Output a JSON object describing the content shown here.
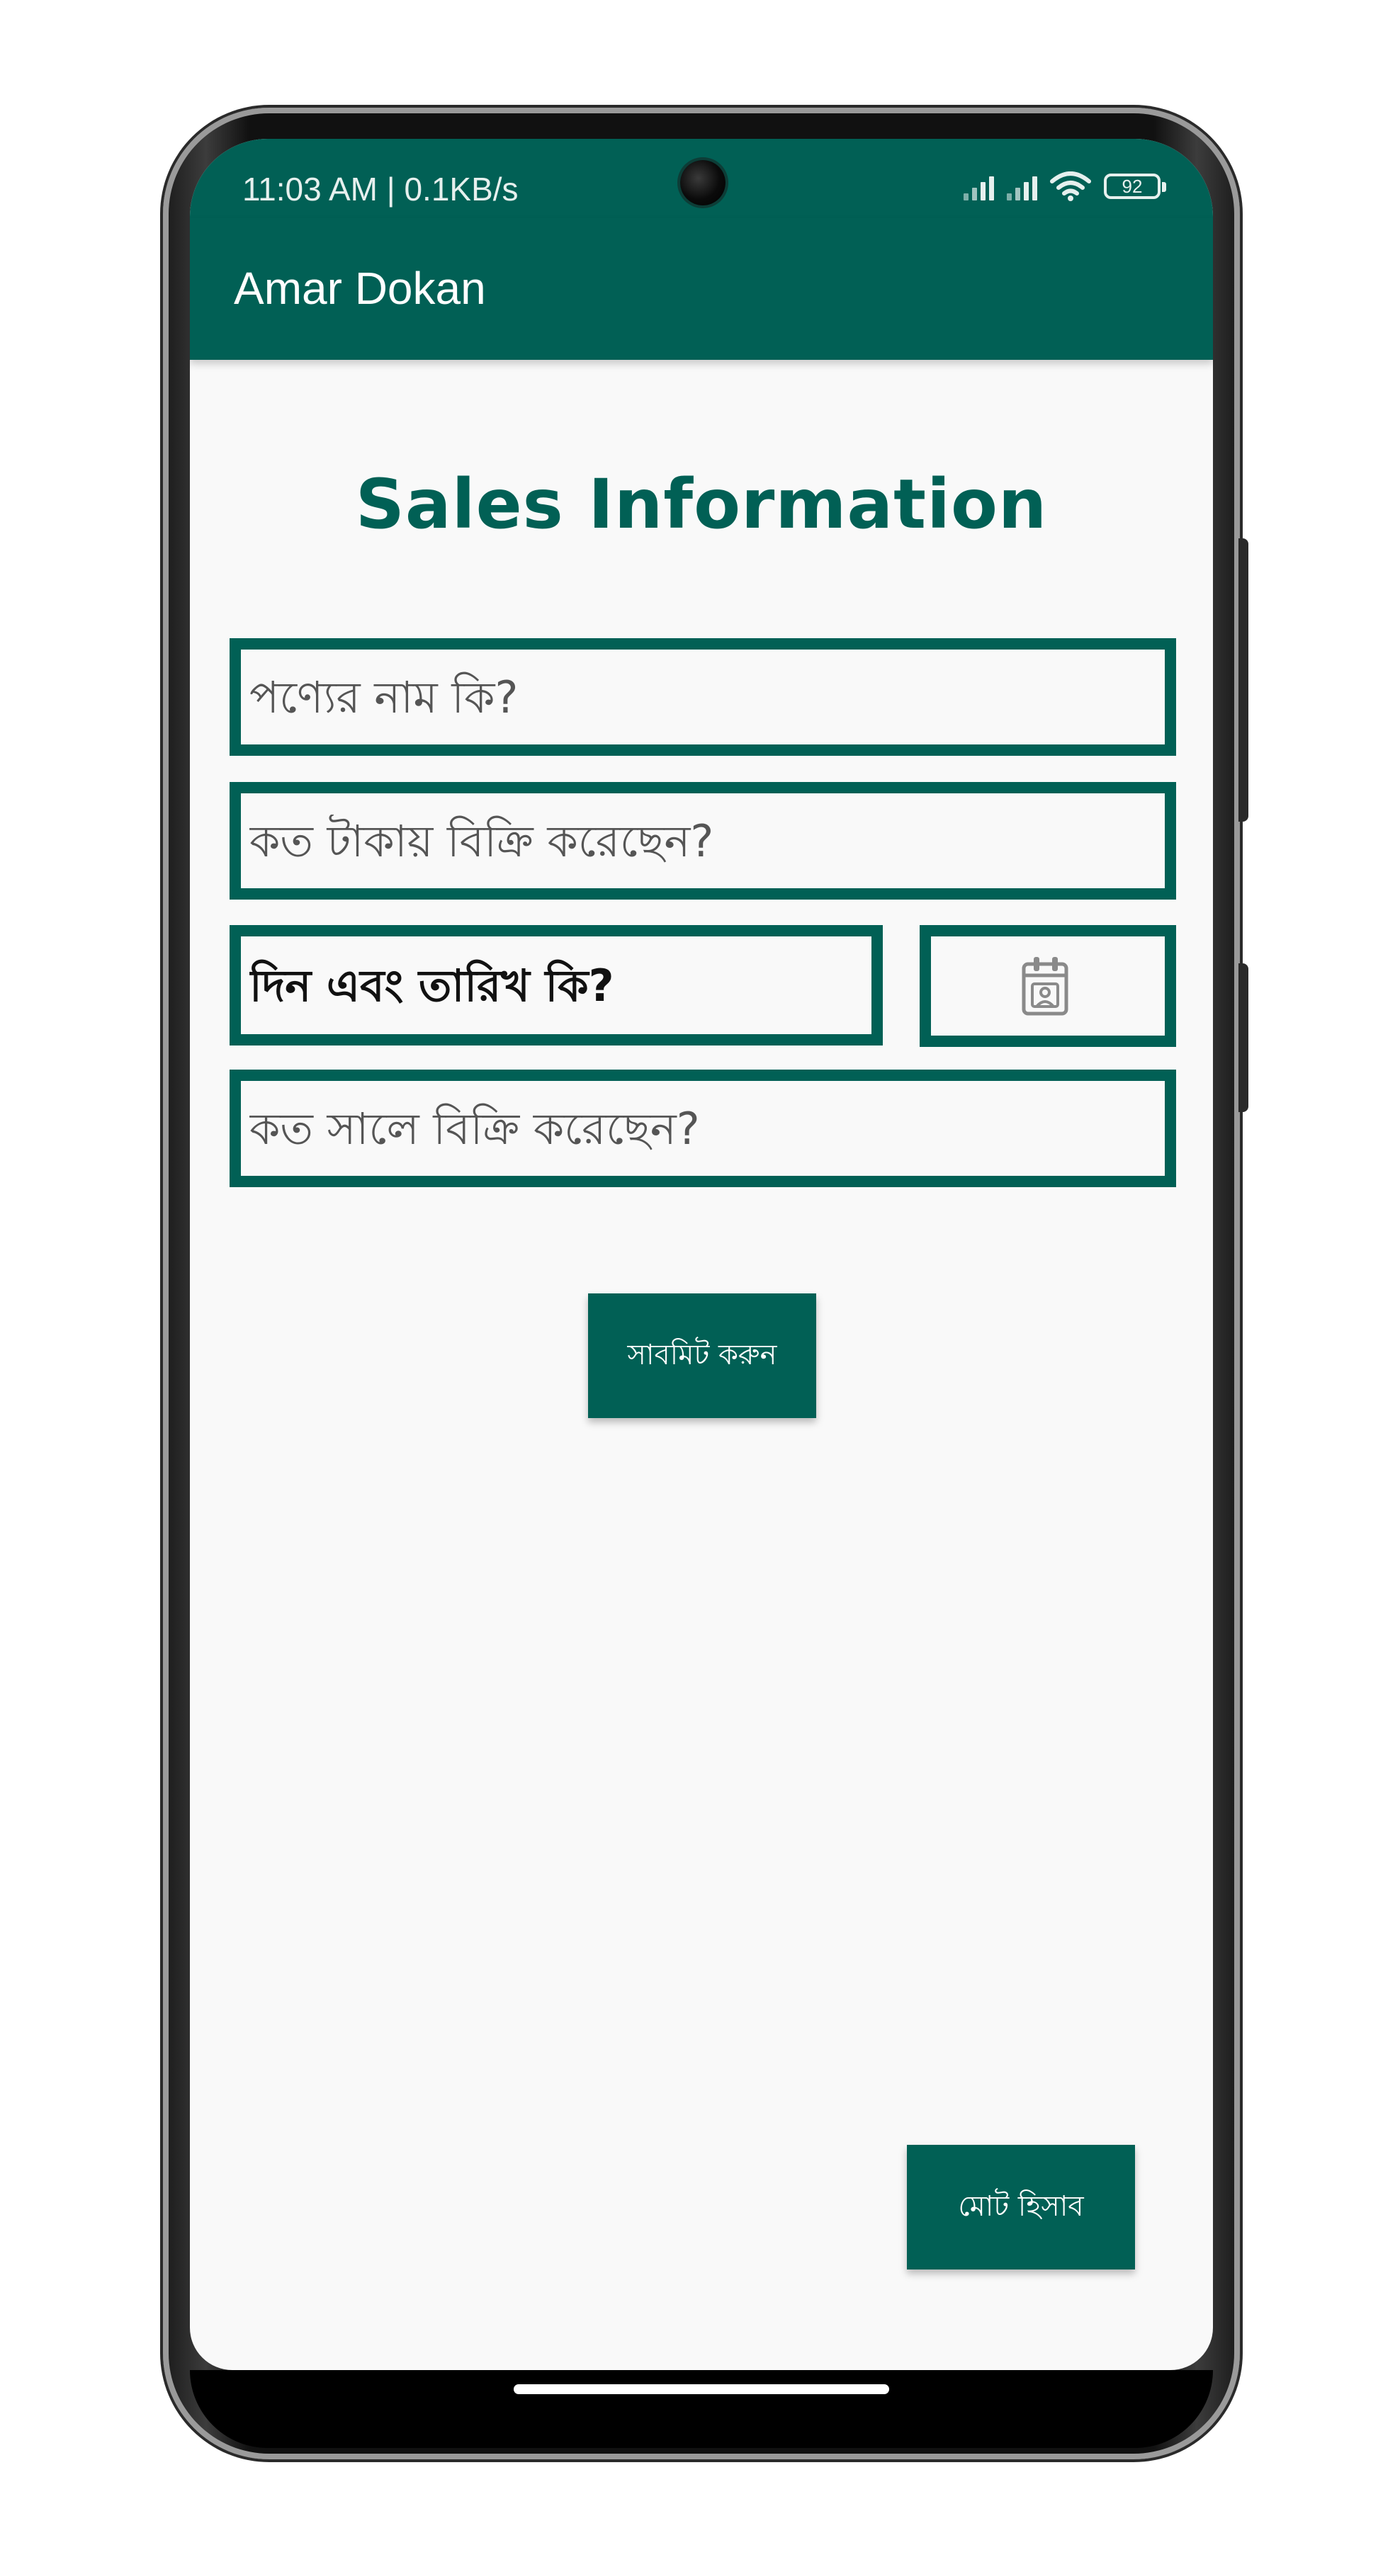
{
  "status_bar": {
    "time_speed": "11:03 AM | 0.1KB/s",
    "battery": "92"
  },
  "app_bar": {
    "title": "Amar Dokan"
  },
  "form": {
    "heading": "Sales Information",
    "product_name_placeholder": "পণ্যের নাম কি?",
    "price_placeholder": "কত টাকায় বিক্রি করেছেন?",
    "date_placeholder": "দিন এবং তারিখ কি?",
    "year_placeholder": "কত সালে বিক্রি করেছেন?",
    "date_picker_icon": "calendar-icon",
    "submit_label": "সাবমিট করুন"
  },
  "footer": {
    "total_label": "মোট হিসাব"
  },
  "colors": {
    "primary": "#016055",
    "background": "#f9f9f9",
    "on_primary": "#ffffff"
  }
}
